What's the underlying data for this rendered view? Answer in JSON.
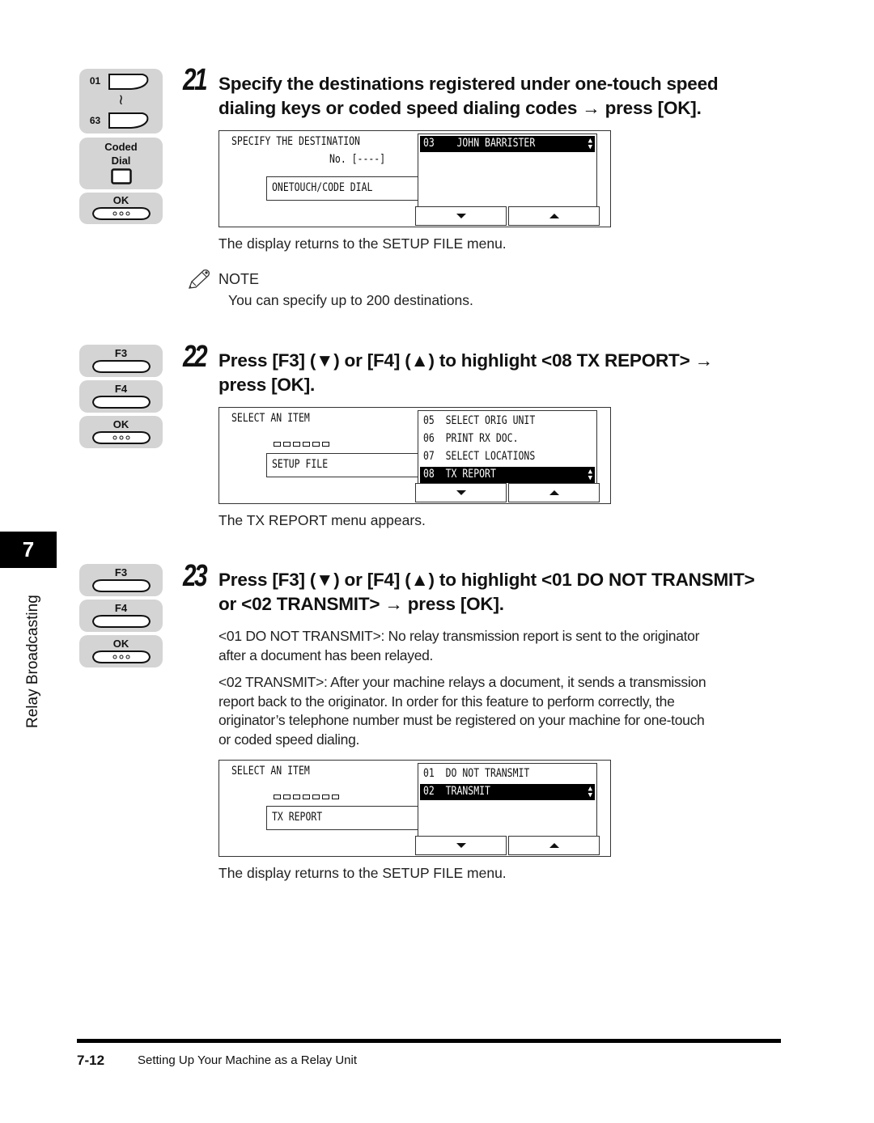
{
  "chapter": {
    "number": "7",
    "title": "Relay Broadcasting"
  },
  "footer": {
    "page_number": "7-12",
    "section_title": "Setting Up Your Machine as a Relay Unit"
  },
  "steps": [
    {
      "number": "21",
      "title_line1": "Specify the destinations registered under one-touch speed",
      "title_line2": "dialing keys or coded speed dialing codes → press [OK].",
      "keys": {
        "onetouch_from": "01",
        "onetouch_to": "63",
        "range_symbol": "≀",
        "coded_dial_line1": "Coded",
        "coded_dial_line2": "Dial",
        "ok": "OK"
      },
      "lcd": {
        "heading": "SPECIFY THE DESTINATION",
        "subline": "No. [----]",
        "main_box": "ONETOUCH/CODE DIAL",
        "list": [
          {
            "text": "03    JOHN BARRISTER",
            "highlighted": true
          }
        ],
        "buttons": [
          "down-arrow",
          "up-arrow"
        ]
      },
      "result": "The display returns to the SETUP FILE menu.",
      "note": {
        "label": "NOTE",
        "text": "You can specify up to 200 destinations."
      }
    },
    {
      "number": "22",
      "title_line1": "Press [F3] (▼) or [F4] (▲) to highlight <08 TX REPORT> →",
      "title_line2": "press [OK].",
      "keys": {
        "f3": "F3",
        "f4": "F4",
        "ok": "OK"
      },
      "lcd": {
        "heading": "SELECT AN ITEM",
        "dots_count": 6,
        "main_box": "SETUP FILE",
        "list": [
          {
            "text": "05  SELECT ORIG UNIT",
            "highlighted": false
          },
          {
            "text": "06  PRINT RX DOC.",
            "highlighted": false
          },
          {
            "text": "07  SELECT LOCATIONS",
            "highlighted": false
          },
          {
            "text": "08  TX REPORT",
            "highlighted": true
          }
        ],
        "buttons": [
          "down-arrow",
          "up-arrow"
        ]
      },
      "result": "The TX REPORT menu appears."
    },
    {
      "number": "23",
      "title_line1": "Press [F3] (▼) or [F4] (▲) to highlight <01 DO NOT TRANSMIT>",
      "title_line2": "or <02 TRANSMIT> → press [OK].",
      "keys": {
        "f3": "F3",
        "f4": "F4",
        "ok": "OK"
      },
      "desc1_line1": "<01 DO NOT TRANSMIT>: No relay transmission report is sent to the originator",
      "desc1_line2": "after a document has been relayed.",
      "desc2_line1": "<02 TRANSMIT>: After your machine relays a document, it sends a transmission",
      "desc2_line2": "report back to the originator. In order for this feature to perform correctly, the",
      "desc2_line3": "originator’s telephone number must be registered on your machine for one-touch",
      "desc2_line4": "or coded speed dialing.",
      "lcd": {
        "heading": "SELECT AN ITEM",
        "dots_count": 7,
        "main_box": "TX REPORT",
        "list": [
          {
            "text": "01  DO NOT TRANSMIT",
            "highlighted": false
          },
          {
            "text": "02  TRANSMIT",
            "highlighted": true
          }
        ],
        "buttons": [
          "down-arrow",
          "up-arrow"
        ]
      },
      "result": "The display returns to the SETUP FILE menu."
    }
  ]
}
